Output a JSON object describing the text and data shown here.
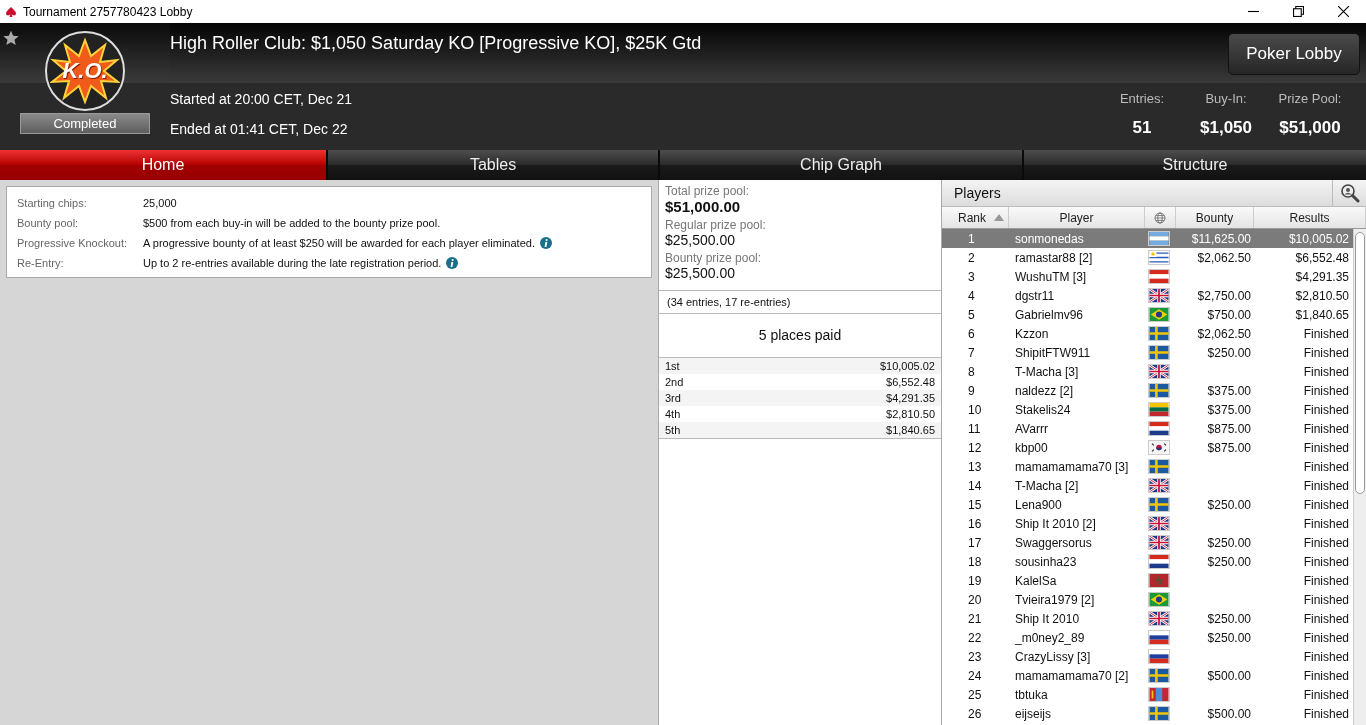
{
  "window": {
    "title": "Tournament 2757780423 Lobby"
  },
  "header": {
    "logo_text": "K.O.",
    "status": "Completed",
    "title": "High Roller Club: $1,050 Saturday KO [Progressive KO], $25K Gtd",
    "started": "Started at 20:00 CET, Dec 21",
    "ended": "Ended at 01:41 CET, Dec 22",
    "lobby_button": "Poker Lobby",
    "stats": [
      {
        "label": "Entries:",
        "value": "51"
      },
      {
        "label": "Buy-In:",
        "value": "$1,050"
      },
      {
        "label": "Prize Pool:",
        "value": "$51,000"
      }
    ]
  },
  "tabs": [
    {
      "label": "Home",
      "selected": true
    },
    {
      "label": "Tables",
      "selected": false
    },
    {
      "label": "Chip Graph",
      "selected": false
    },
    {
      "label": "Structure",
      "selected": false
    }
  ],
  "info": [
    {
      "label": "Starting chips:",
      "value": "25,000",
      "info": false
    },
    {
      "label": "Bounty pool:",
      "value": "$500 from each buy-in will be added to the bounty prize pool.",
      "info": false
    },
    {
      "label": "Progressive Knockout:",
      "value": "A progressive bounty of at least $250 will be awarded for each player eliminated.",
      "info": true
    },
    {
      "label": "Re-Entry:",
      "value": "Up to 2 re-entries available during the late registration period.",
      "info": true
    }
  ],
  "prizes": {
    "pools": [
      {
        "label": "Total prize pool:",
        "value": "$51,000.00",
        "major": true
      },
      {
        "label": "Regular prize pool:",
        "value": "$25,500.00",
        "major": false
      },
      {
        "label": "Bounty prize pool:",
        "value": "$25,500.00",
        "major": false
      }
    ],
    "entries_note": "(34 entries, 17 re-entries)",
    "places_paid": "5 places paid",
    "payouts": [
      {
        "place": "1st",
        "amount": "$10,005.02"
      },
      {
        "place": "2nd",
        "amount": "$6,552.48"
      },
      {
        "place": "3rd",
        "amount": "$4,291.35"
      },
      {
        "place": "4th",
        "amount": "$2,810.50"
      },
      {
        "place": "5th",
        "amount": "$1,840.65"
      }
    ]
  },
  "players": {
    "title": "Players",
    "columns": [
      "Rank",
      "Player",
      "Bounty",
      "Results"
    ],
    "rows": [
      {
        "rank": "1",
        "player": "sonmonedas",
        "kind": "ar",
        "bounty": "$11,625.00",
        "result": "$10,005.02",
        "selected": true
      },
      {
        "rank": "2",
        "player": "ramastar88 [2]",
        "kind": "uy",
        "bounty": "$2,062.50",
        "result": "$6,552.48",
        "selected": false
      },
      {
        "rank": "3",
        "player": "WushuTM [3]",
        "kind": "at",
        "result": "$4,291.35",
        "selected": false
      },
      {
        "rank": "4",
        "player": "dgstr11",
        "kind": "gb",
        "bounty": "$2,750.00",
        "result": "$2,810.50",
        "selected": false
      },
      {
        "rank": "5",
        "player": "Gabrielmv96",
        "kind": "br",
        "bounty": "$750.00",
        "result": "$1,840.65",
        "selected": false
      },
      {
        "rank": "6",
        "player": "Kzzon",
        "kind": "se",
        "bounty": "$2,062.50",
        "result": "Finished",
        "selected": false
      },
      {
        "rank": "7",
        "player": "ShipitFTW911",
        "kind": "se",
        "bounty": "$250.00",
        "result": "Finished",
        "selected": false
      },
      {
        "rank": "8",
        "player": "T-Macha [3]",
        "kind": "gb",
        "result": "Finished",
        "selected": false
      },
      {
        "rank": "9",
        "player": "naldezz [2]",
        "kind": "se",
        "bounty": "$375.00",
        "result": "Finished",
        "selected": false
      },
      {
        "rank": "10",
        "player": "Stakelis24",
        "kind": "lt",
        "bounty": "$375.00",
        "result": "Finished",
        "selected": false
      },
      {
        "rank": "11",
        "player": "AVarrr",
        "kind": "hr",
        "bounty": "$875.00",
        "result": "Finished",
        "selected": false
      },
      {
        "rank": "12",
        "player": "kbp00",
        "kind": "kr",
        "bounty": "$875.00",
        "result": "Finished",
        "selected": false
      },
      {
        "rank": "13",
        "player": "mamamamama70 [3]",
        "kind": "se",
        "result": "Finished",
        "selected": false
      },
      {
        "rank": "14",
        "player": "T-Macha [2]",
        "kind": "gb",
        "result": "Finished",
        "selected": false
      },
      {
        "rank": "15",
        "player": "Lena900",
        "kind": "se",
        "bounty": "$250.00",
        "result": "Finished",
        "selected": false
      },
      {
        "rank": "16",
        "player": "Ship It 2010 [2]",
        "kind": "gb",
        "result": "Finished",
        "selected": false
      },
      {
        "rank": "17",
        "player": "Swaggersorus",
        "kind": "gb",
        "bounty": "$250.00",
        "result": "Finished",
        "selected": false
      },
      {
        "rank": "18",
        "player": "sousinha23",
        "kind": "hr",
        "bounty": "$250.00",
        "result": "Finished",
        "selected": false
      },
      {
        "rank": "19",
        "player": "KalelSa",
        "kind": "ma",
        "result": "Finished",
        "selected": false
      },
      {
        "rank": "20",
        "player": "Tvieira1979 [2]",
        "kind": "br",
        "result": "Finished",
        "selected": false
      },
      {
        "rank": "21",
        "player": "Ship It 2010",
        "kind": "gb",
        "bounty": "$250.00",
        "result": "Finished",
        "selected": false
      },
      {
        "rank": "22",
        "player": "_m0ney2_89",
        "kind": "ru",
        "bounty": "$250.00",
        "result": "Finished",
        "selected": false
      },
      {
        "rank": "23",
        "player": "CrazyLissy [3]",
        "kind": "ru",
        "result": "Finished",
        "selected": false
      },
      {
        "rank": "24",
        "player": "mamamamama70 [2]",
        "kind": "se",
        "bounty": "$500.00",
        "result": "Finished",
        "selected": false
      },
      {
        "rank": "25",
        "player": "tbtuka",
        "kind": "mn",
        "result": "Finished",
        "selected": false
      },
      {
        "rank": "26",
        "player": "eijseijs",
        "kind": "se",
        "bounty": "$500.00",
        "result": "Finished",
        "selected": false
      }
    ]
  }
}
